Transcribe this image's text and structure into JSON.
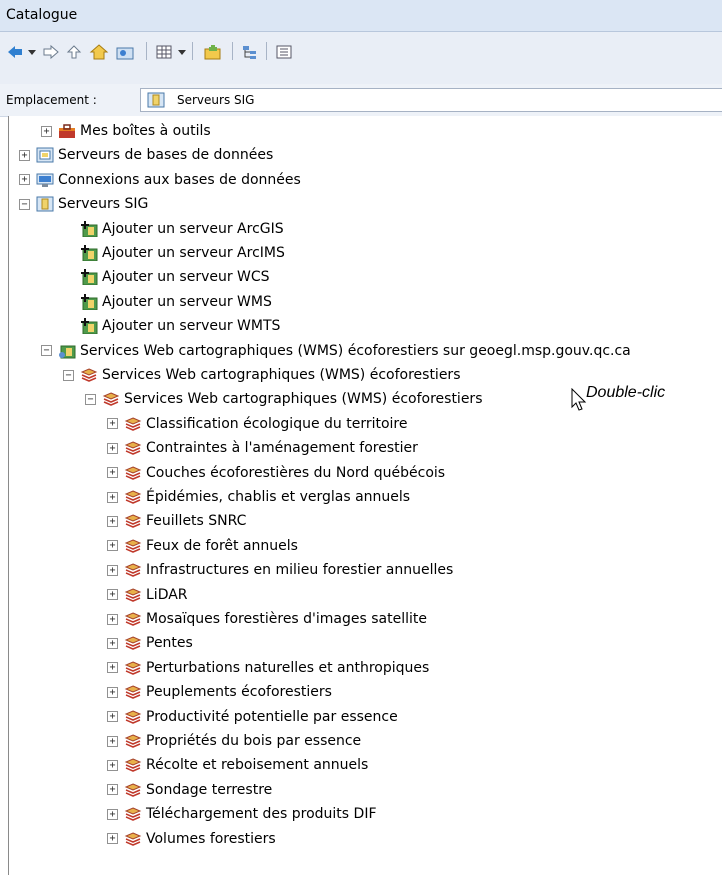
{
  "window": {
    "title": "Catalogue"
  },
  "toolbar": {
    "icons": [
      "back-arrow-icon",
      "dropdown-icon",
      "forward-arrow-icon",
      "up-level-icon",
      "home-folder-icon",
      "connect-folder-icon",
      "view-grid-icon",
      "dropdown-icon",
      "new-item-icon",
      "tree-view-icon",
      "list-view-icon"
    ]
  },
  "location": {
    "label": "Emplacement :",
    "value": "Serveurs SIG"
  },
  "tree": {
    "items": [
      {
        "label": "Mes boîtes à outils",
        "indent": 1,
        "expander": "+",
        "icon": "toolbox-icon"
      },
      {
        "label": "Serveurs de bases de données",
        "indent": 0,
        "expander": "+",
        "icon": "database-server-icon"
      },
      {
        "label": "Connexions aux bases de données",
        "indent": 0,
        "expander": "+",
        "icon": "database-connection-icon"
      },
      {
        "label": "Serveurs SIG",
        "indent": 0,
        "expander": "−",
        "icon": "gis-server-icon"
      },
      {
        "label": "Ajouter un serveur ArcGIS",
        "indent": 2,
        "expander": "",
        "icon": "add-server-icon"
      },
      {
        "label": "Ajouter un serveur ArcIMS",
        "indent": 2,
        "expander": "",
        "icon": "add-server-icon"
      },
      {
        "label": "Ajouter un serveur WCS",
        "indent": 2,
        "expander": "",
        "icon": "add-server-icon"
      },
      {
        "label": "Ajouter un serveur WMS",
        "indent": 2,
        "expander": "",
        "icon": "add-server-icon"
      },
      {
        "label": "Ajouter un serveur WMTS",
        "indent": 2,
        "expander": "",
        "icon": "add-server-icon"
      },
      {
        "label": "Services Web cartographiques (WMS) écoforestiers sur geoegl.msp.gouv.qc.ca",
        "indent": 1,
        "expander": "−",
        "icon": "wms-server-icon"
      },
      {
        "label": "Services Web cartographiques (WMS) écoforestiers",
        "indent": 2,
        "expander": "−",
        "icon": "layers-icon"
      },
      {
        "label": "Services Web cartographiques (WMS) écoforestiers",
        "indent": 3,
        "expander": "−",
        "icon": "layers-icon"
      },
      {
        "label": "Classification écologique du territoire",
        "indent": 4,
        "expander": "+",
        "icon": "layers-icon"
      },
      {
        "label": "Contraintes à l'aménagement forestier",
        "indent": 4,
        "expander": "+",
        "icon": "layers-icon"
      },
      {
        "label": "Couches écoforestières du Nord québécois",
        "indent": 4,
        "expander": "+",
        "icon": "layers-icon"
      },
      {
        "label": "Épidémies, chablis et verglas annuels",
        "indent": 4,
        "expander": "+",
        "icon": "layers-icon"
      },
      {
        "label": "Feuillets SNRC",
        "indent": 4,
        "expander": "+",
        "icon": "layers-icon"
      },
      {
        "label": "Feux de forêt annuels",
        "indent": 4,
        "expander": "+",
        "icon": "layers-icon"
      },
      {
        "label": "Infrastructures en milieu forestier annuelles",
        "indent": 4,
        "expander": "+",
        "icon": "layers-icon"
      },
      {
        "label": "LiDAR",
        "indent": 4,
        "expander": "+",
        "icon": "layers-icon"
      },
      {
        "label": "Mosaïques forestières d'images satellite",
        "indent": 4,
        "expander": "+",
        "icon": "layers-icon"
      },
      {
        "label": "Pentes",
        "indent": 4,
        "expander": "+",
        "icon": "layers-icon"
      },
      {
        "label": "Perturbations naturelles et anthropiques",
        "indent": 4,
        "expander": "+",
        "icon": "layers-icon"
      },
      {
        "label": "Peuplements écoforestiers",
        "indent": 4,
        "expander": "+",
        "icon": "layers-icon"
      },
      {
        "label": "Productivité potentielle par essence",
        "indent": 4,
        "expander": "+",
        "icon": "layers-icon"
      },
      {
        "label": "Propriétés du bois par essence",
        "indent": 4,
        "expander": "+",
        "icon": "layers-icon"
      },
      {
        "label": "Récolte et reboisement annuels",
        "indent": 4,
        "expander": "+",
        "icon": "layers-icon"
      },
      {
        "label": "Sondage terrestre",
        "indent": 4,
        "expander": "+",
        "icon": "layers-icon"
      },
      {
        "label": "Téléchargement des produits DIF",
        "indent": 4,
        "expander": "+",
        "icon": "layers-icon"
      },
      {
        "label": "Volumes forestiers",
        "indent": 4,
        "expander": "+",
        "icon": "layers-icon"
      }
    ]
  },
  "annotation": {
    "text": "Double-clic"
  }
}
